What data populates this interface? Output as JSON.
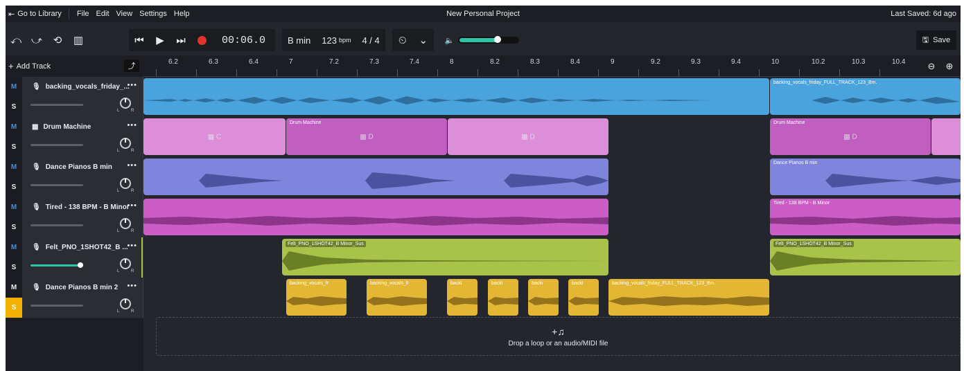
{
  "menubar": {
    "go_to_library": "Go to Library",
    "menus": [
      "File",
      "Edit",
      "View",
      "Settings",
      "Help"
    ],
    "project_title": "New Personal Project",
    "last_saved": "Last Saved: 6d ago"
  },
  "toolbar": {
    "time": "00:06.0",
    "key": "B min",
    "bpm": "123",
    "bpm_unit": "bpm",
    "time_signature": "4 / 4",
    "save_label": "Save",
    "volume_level": 0.65
  },
  "add_track_label": "Add Track",
  "ruler_ticks": [
    "6.2",
    "6.3",
    "6.4",
    "7",
    "7.2",
    "7.3",
    "7.4",
    "8",
    "8.2",
    "8.3",
    "8.4",
    "9",
    "9.2",
    "9.3",
    "9.4",
    "10",
    "10.2",
    "10.3",
    "10.4"
  ],
  "tracks": [
    {
      "name": "backing_vocals_friday_...",
      "icon": "microphone-icon"
    },
    {
      "name": "Drum Machine",
      "icon": "drum-machine-icon"
    },
    {
      "name": "Dance Pianos B min",
      "icon": "microphone-icon"
    },
    {
      "name": "Tired - 138 BPM - B Minor",
      "icon": "microphone-icon"
    },
    {
      "name": "Felt_PNO_1SHOT42_B ...",
      "icon": "microphone-icon"
    },
    {
      "name": "Dance Pianos B min 2",
      "icon": "microphone-icon"
    }
  ],
  "clips": {
    "vocals_right": "backing_vocals_friday_FULL_TRACK_123_Bm.",
    "drum_c": "C",
    "drum_machine": "Drum Machine",
    "drum_d": "D",
    "drum_machine_right": "Drum Machine",
    "drum_d_right": "D",
    "pianos_right": "Dance Pianos B min",
    "tired_right": "Tired - 138 BPM - B Minor",
    "felt": "Felt_PNO_1SHOT42_B Minor_Sus",
    "felt_right": "Felt_PNO_1SHOT42_B Minor_Sus",
    "yellow_1": "backing_vocals_fr",
    "yellow_2": "backing_vocals_fr",
    "yellow_3": "backi",
    "yellow_4": "backi",
    "yellow_5": "backi",
    "yellow_6": "backi",
    "yellow_long": "backing_vocals_friday_FULL_TRACK_123_Bm."
  },
  "colors": {
    "vocals": "#4aa3dd",
    "drum": "#dc8fd8",
    "drum_dark": "#c05fc0",
    "pianos": "#7f85dc",
    "tired": "#cc5cc6",
    "felt": "#a8c24a",
    "yellow": "#e3b634",
    "solo": "#f2b100",
    "accent": "#2ec4a8"
  },
  "dropzone_text": "Drop a loop or an audio/MIDI file"
}
